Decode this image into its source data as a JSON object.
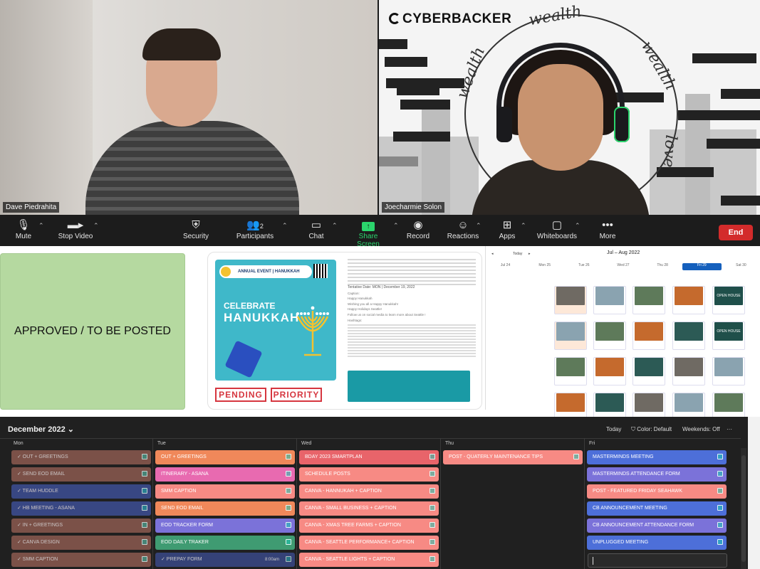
{
  "video": {
    "left_name": "Dave Piedrahita",
    "right_name": "Joecharmie Solon",
    "brand": "CYBERBACKER",
    "wealth_words": [
      "wealth",
      "wealth",
      "wealth",
      "love"
    ]
  },
  "toolbar": {
    "mute": "Mute",
    "stop_video": "Stop Video",
    "security": "Security",
    "participants": "Participants",
    "participants_count": "2",
    "chat": "Chat",
    "share_screen": "Share Screen",
    "record": "Record",
    "reactions": "Reactions",
    "apps": "Apps",
    "whiteboards": "Whiteboards",
    "more": "More",
    "end": "End"
  },
  "shared": {
    "approved_label": "APPROVED / TO BE POSTED",
    "post": {
      "banner": "ANNUAL EVENT | HANUKKAH",
      "celebrate": "CELEBRATE",
      "hanukkah": "HANUKKAH",
      "pending": "PENDING",
      "priority": "PRIORITY",
      "tentative": "Tentative Date: MON | December 19, 2022",
      "caption_label": "Caption:",
      "caption_line1": "Happy Hanukkah",
      "caption_line2": "Wishing you all a Happy Hanukkah!",
      "caption_line3": "Happy Holidays Seattle!",
      "caption_line4": "Follow us on social media to learn more about Seattle !",
      "hashtags_label": "Hashtags:"
    },
    "cal": {
      "month": "Jul – Aug 2022",
      "today_btn": "Today",
      "days": [
        "Jul 24",
        "Mon 25",
        "Tue 26",
        "Wed 27",
        "Thu 28",
        "Fri 29",
        "Sat 30"
      ],
      "open_house": "OPEN HOUSE"
    }
  },
  "calendar": {
    "month_title": "December 2022",
    "today": "Today",
    "color": "Color: Default",
    "weekends": "Weekends: Off",
    "more": "···",
    "day_names": [
      "Mon",
      "Tue",
      "Wed",
      "Thu",
      "Fri"
    ],
    "mon": [
      "OUT + GREETINGS",
      "SEND EOD EMAIL",
      "TEAM HUDDLE",
      "HB MEETING - ASANA",
      "IN + GREETINGS",
      "CANVA DESIGN",
      "SMM CAPTION"
    ],
    "tue": [
      "OUT + GREETINGS",
      "ITINERARY - ASANA",
      "SMM CAPTION",
      "SEND EOD EMAIL",
      "EOD TRACKER FORM",
      "EOD DAILY TRAKER",
      "PREPAY FORM"
    ],
    "tue_time": "8:00am",
    "wed": [
      "BDAY 2023 SMARTPLAN",
      "SCHEDULE POSTS",
      "CANVA - HANNUKAH + CAPTION",
      "CANVA - SMALL BUSINESS + CAPTION",
      "CANVA - XMAS TREE FARMS + CAPTION",
      "CANVA - SEATTLE PERFORMANCE+ CAPTION",
      "CANVA - SEATTLE LIGHTS + CAPTION"
    ],
    "thu": [
      "POST - QUATERLY MAINTENANCE TIPS"
    ],
    "fri": [
      "MASTERMINDS MEETING",
      "MASTERMINDS ATTENDANCE FORM",
      "POST - FEATURED FRIDAY SEAHAWK",
      "CB ANNOUNCEMENT MEETING",
      "CB ANNOUNCEMENT ATTENDANCE FORM",
      "UNPLUGGED MEETING"
    ]
  },
  "colors": {
    "brown": "#8b5a4f",
    "blue_dark": "#3d4e95",
    "orange": "#f0885a",
    "pink": "#e86ab0",
    "salmon": "#f78a84",
    "purple": "#7b72d9",
    "green": "#3f9b72",
    "red": "#e8646a",
    "royal": "#4d6fd9",
    "end": "#d32b2b",
    "share_green": "#2bd46c"
  }
}
